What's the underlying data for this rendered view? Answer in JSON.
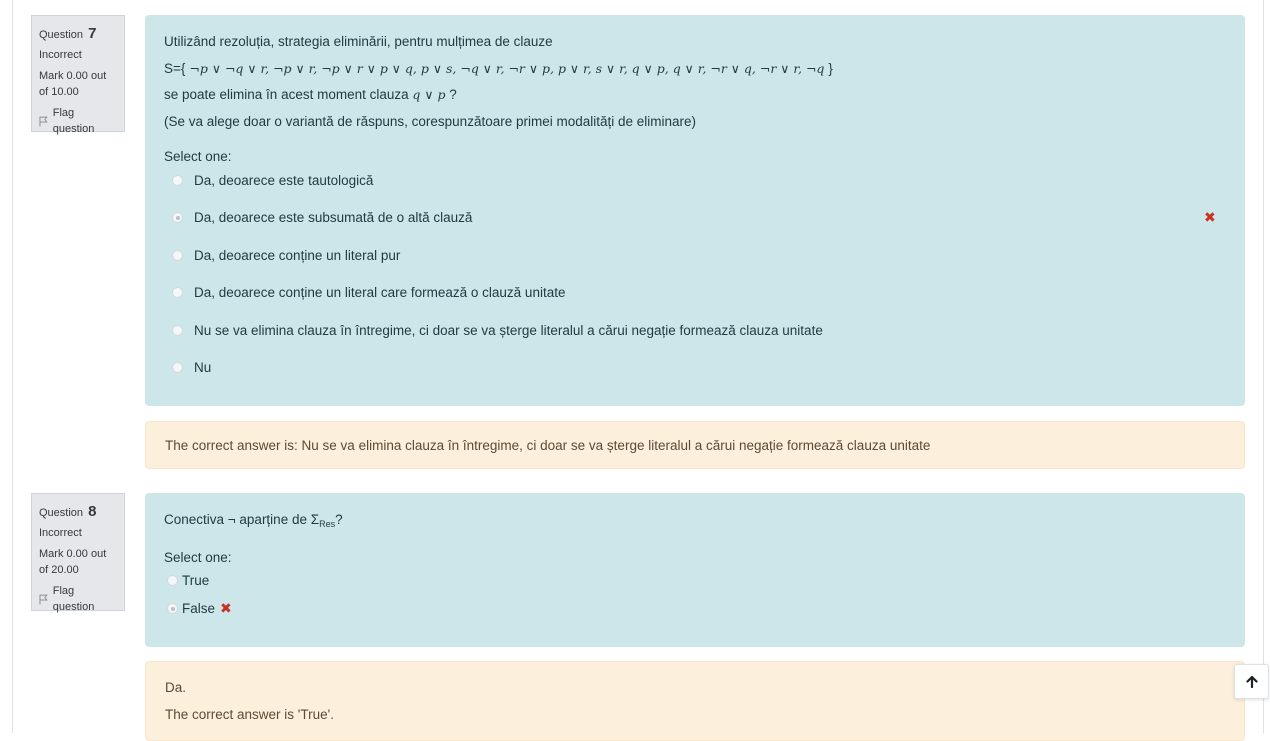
{
  "q7": {
    "question_label": "Question",
    "number": "7",
    "state": "Incorrect",
    "mark": "Mark 0.00 out of 10.00",
    "flag": "Flag question",
    "text1": "Utilizând rezoluția, strategia eliminării, pentru mulțimea de clauze",
    "set_prefix": "S={",
    "set_body": " ¬p ∨ ¬q ∨ r,  ¬p ∨ r,  ¬p ∨ r ∨ p ∨ q,  p ∨ s,  ¬q ∨ r,  ¬r ∨ p,  p ∨ r,  s ∨ r,   q ∨ p,  q ∨ r,  ¬r ∨ q,  ¬r ∨ r,  ¬q ",
    "set_suffix": "}",
    "text3_pre": "se poate elimina în acest moment clauza ",
    "text3_clause": "q ∨ p",
    "text3_post": " ?",
    "text4": "(Se va alege doar o variantă de răspuns, corespunzătoare primei modalități de eliminare)",
    "select_one": "Select one:",
    "options": [
      "Da, deoarece este tautologică",
      "Da, deoarece este subsumată de o altă clauză",
      "Da, deoarece conține un literal pur",
      "Da, deoarece conține un literal care formează o clauză unitate",
      "Nu se va elimina clauza în întregime, ci doar se va șterge literalul a cărui negație formează clauza unitate",
      "Nu"
    ],
    "selected_index": 1,
    "incorrect_mark": "✖",
    "feedback": "The correct answer is: Nu se va elimina clauza în întregime, ci doar se va șterge literalul a cărui negație formează clauza unitate"
  },
  "q8": {
    "question_label": "Question",
    "number": "8",
    "state": "Incorrect",
    "mark": "Mark 0.00 out of 20.00",
    "flag": "Flag question",
    "text_pre": "Conectiva ¬ aparține de Σ",
    "text_sub": "Res",
    "text_post": "?",
    "select_one": "Select one:",
    "options": [
      "True",
      "False"
    ],
    "selected_index": 1,
    "incorrect_mark": "✖",
    "feedback_general": "Da.",
    "feedback": "The correct answer is 'True'."
  },
  "colors": {
    "formulation_bg": "#cce6ea",
    "outcome_bg": "#fcefdc",
    "info_bg": "#e5e7ea",
    "incorrect": "#ca3120"
  },
  "icons": [
    "flag-icon",
    "arrow-up-icon",
    "cross-icon"
  ]
}
